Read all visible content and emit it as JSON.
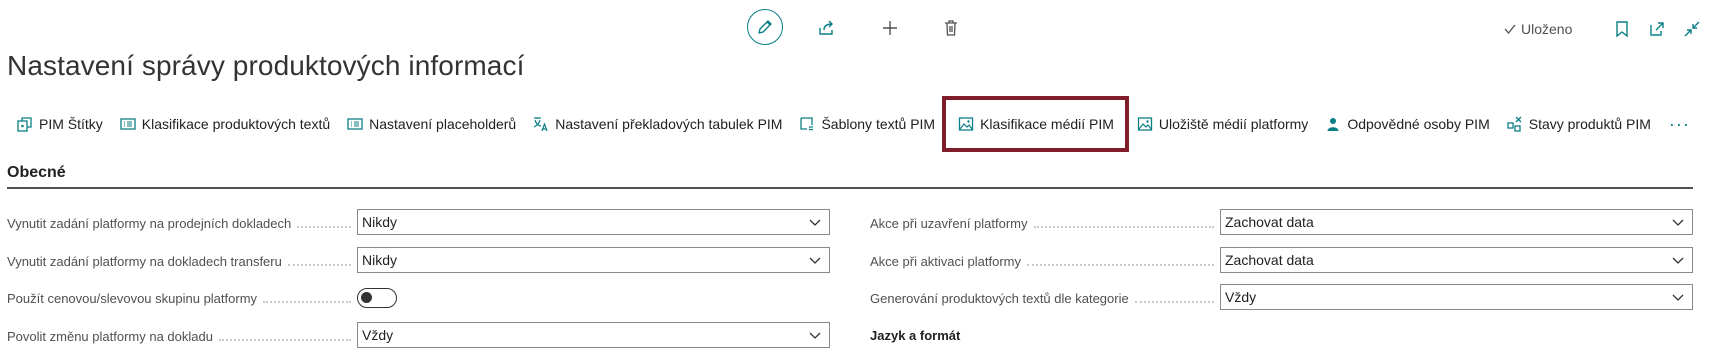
{
  "toolbar": {
    "edit_icon": "pencil-icon",
    "share_icon": "share-icon",
    "new_icon": "plus-icon",
    "delete_icon": "trash-icon",
    "saved_label": "Uloženo",
    "bookmark_icon": "bookmark-icon",
    "open_new_icon": "open-in-new-window-icon",
    "collapse_icon": "collapse-icon"
  },
  "page": {
    "title": "Nastavení správy produktových informací"
  },
  "actions": [
    {
      "label": "PIM Štítky",
      "icon": "tags-icon"
    },
    {
      "label": "Klasifikace produktových textů",
      "icon": "list-icon"
    },
    {
      "label": "Nastavení placeholderů",
      "icon": "list-icon"
    },
    {
      "label": "Nastavení překladových tabulek PIM",
      "icon": "translate-icon"
    },
    {
      "label": "Šablony textů PIM",
      "icon": "template-icon"
    },
    {
      "label": "Klasifikace médií PIM",
      "icon": "image-icon",
      "highlighted": true
    },
    {
      "label": "Uložiště médií platformy",
      "icon": "image-icon"
    },
    {
      "label": "Odpovědné osoby PIM",
      "icon": "person-icon"
    },
    {
      "label": "Stavy produktů PIM",
      "icon": "status-icon"
    }
  ],
  "more_label": "···",
  "section": {
    "title": "Obecné"
  },
  "fields_left": [
    {
      "label": "Vynutit zadání platformy na prodejních dokladech",
      "value": "Nikdy",
      "type": "select"
    },
    {
      "label": "Vynutit zadání platformy na dokladech transferu",
      "value": "Nikdy",
      "type": "select"
    },
    {
      "label": "Použít cenovou/slevovou skupinu platformy",
      "value": "",
      "type": "toggle",
      "on": false
    },
    {
      "label": "Povolit změnu platformy na dokladu",
      "value": "Vždy",
      "type": "select"
    }
  ],
  "fields_right": [
    {
      "label": "Akce při uzavření platformy",
      "value": "Zachovat data",
      "type": "select"
    },
    {
      "label": "Akce při aktivaci platformy",
      "value": "Zachovat data",
      "type": "select"
    },
    {
      "label": "Generování produktových textů dle kategorie",
      "value": "Vždy",
      "type": "select"
    }
  ],
  "subsection": {
    "title": "Jazyk a formát"
  },
  "colors": {
    "accent": "#0b7f86",
    "highlight": "#7f1d2a"
  }
}
